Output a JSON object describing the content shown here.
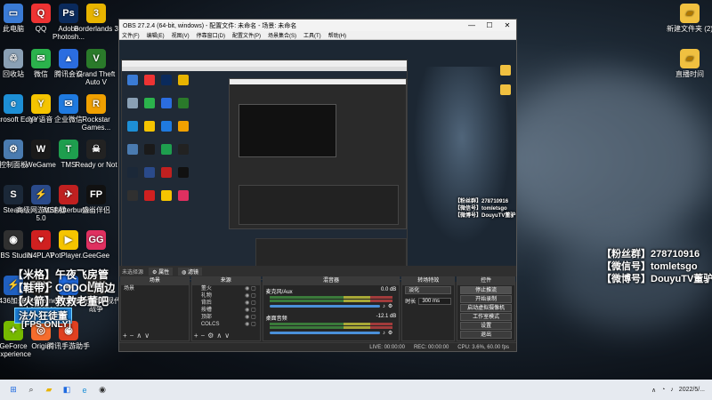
{
  "desktop_left": [
    {
      "label": "此电脑",
      "color": "#3a7bd5",
      "glyph": "▭"
    },
    {
      "label": "QQ",
      "color": "#e33",
      "glyph": "Q"
    },
    {
      "label": "Adobe Photosh...",
      "color": "#0a2a5c",
      "glyph": "Ps"
    },
    {
      "label": "Borderlands 3",
      "color": "#e8b400",
      "glyph": "3"
    },
    {
      "label": "回收站",
      "color": "#8aa0b5",
      "glyph": "♲"
    },
    {
      "label": "微信",
      "color": "#2bb24c",
      "glyph": "✉"
    },
    {
      "label": "腾讯会议",
      "color": "#2b6de0",
      "glyph": "▲"
    },
    {
      "label": "Grand Theft Auto V",
      "color": "#2a7a2a",
      "glyph": "V"
    },
    {
      "label": "Microsoft Edge",
      "color": "#1d8fd6",
      "glyph": "e"
    },
    {
      "label": "YY语音",
      "color": "#f5c400",
      "glyph": "Y"
    },
    {
      "label": "企业微信",
      "color": "#1f7ae0",
      "glyph": "✉"
    },
    {
      "label": "Rockstar Games...",
      "color": "#f0a000",
      "glyph": "R"
    },
    {
      "label": "控制面板",
      "color": "#4a7bb0",
      "glyph": "⚙"
    },
    {
      "label": "WeGame",
      "color": "#1a1a1a",
      "glyph": "W"
    },
    {
      "label": "TMS",
      "color": "#1e9e4e",
      "glyph": "T"
    },
    {
      "label": "Ready or Not",
      "color": "#222",
      "glyph": "☠"
    },
    {
      "label": "Steam",
      "color": "#1b2838",
      "glyph": "S"
    },
    {
      "label": "高级网游加速器5.0",
      "color": "#2a4a8a",
      "glyph": "⚡"
    },
    {
      "label": "MSI Afterburner",
      "color": "#c02020",
      "glyph": "✈"
    },
    {
      "label": "盛当伴侣",
      "color": "#111",
      "glyph": "FP"
    },
    {
      "label": "OBS Studio",
      "color": "#303030",
      "glyph": "◉"
    },
    {
      "label": "N4PLAY",
      "color": "#d02020",
      "glyph": "♥"
    },
    {
      "label": "PotPlayer...",
      "color": "#f5c400",
      "glyph": "▶"
    },
    {
      "label": "GeeGee",
      "color": "#e03060",
      "glyph": "GG"
    },
    {
      "label": "3436加速器",
      "color": "#2060c0",
      "glyph": "⚡"
    },
    {
      "label": "Epic Games Launcher",
      "color": "#222",
      "glyph": "EPIC"
    },
    {
      "label": "ToDesk",
      "color": "#1f6ae0",
      "glyph": "☁"
    },
    {
      "label": "使命召唤：现代战争",
      "color": "#333",
      "glyph": "MW"
    },
    {
      "label": "GeForce Experience",
      "color": "#76b900",
      "glyph": "✦"
    },
    {
      "label": "Origin",
      "color": "#f56c2d",
      "glyph": "◎"
    },
    {
      "label": "腾讯手游助手",
      "color": "#e04020",
      "glyph": "◉"
    }
  ],
  "desktop_right": [
    {
      "label": "新建文件夹 (2)",
      "color": "#f0c040",
      "glyph": "▰"
    },
    {
      "label": "直播时间",
      "color": "#f0c040",
      "glyph": "▰"
    }
  ],
  "overlay_right": {
    "fans": "【粉丝群】278710916",
    "wechat": "【微信号】tomletsgo",
    "weibo": "【微博号】DouyuTV董驴"
  },
  "overlay_left": {
    "line1": "【米格】午夜飞房管",
    "line2": "【鞋带】CODOL周边",
    "line3": "【火箭】救救老董吧",
    "badge": "法外狂徒董",
    "fps": "[FPS ONLY]"
  },
  "obs": {
    "title": "OBS 27.2.4 (64-bit, windows) - 配置文件: 未命名 - 场景: 未命名",
    "menu": [
      "文件(F)",
      "编辑(E)",
      "视图(V)",
      "停靠窗口(D)",
      "配置文件(P)",
      "场景集合(S)",
      "工具(T)",
      "帮助(H)"
    ],
    "no_source": "未选择源",
    "props_tab": "属性",
    "filters_tab": "滤镜",
    "scenes_header": "场景",
    "scenes": [
      "场景"
    ],
    "sources_header": "来源",
    "sources": [
      "董火",
      "礼物",
      "背后",
      "按槽",
      "顶部",
      "COLCS"
    ],
    "mixer_header": "混音器",
    "mixer": [
      {
        "name": "麦克风/Aux",
        "db": "0.0 dB"
      },
      {
        "name": "桌面音频",
        "db": "-12.1 dB"
      }
    ],
    "transitions_header": "转场特效",
    "transition_type": "淡化",
    "duration_label": "时长",
    "duration_value": "300 ms",
    "controls_header": "控件",
    "controls": [
      "停止推流",
      "开始录制",
      "启动虚拟摄像机",
      "工作室模式",
      "设置",
      "退出"
    ],
    "status": {
      "live": "LIVE: 00:00:00",
      "rec": "REC: 00:00:00",
      "cpu": "CPU: 3.6%, 60.00 fps"
    }
  },
  "taskbar": {
    "apps": [
      {
        "name": "windows-icon",
        "glyph": "⊞",
        "color": "#1f6ae0"
      },
      {
        "name": "search-icon",
        "glyph": "⌕",
        "color": "#333"
      },
      {
        "name": "file-explorer-icon",
        "glyph": "▰",
        "color": "#e8b400"
      },
      {
        "name": "store-icon",
        "glyph": "◧",
        "color": "#1f6ae0"
      },
      {
        "name": "edge-icon",
        "glyph": "e",
        "color": "#1d8fd6"
      },
      {
        "name": "obs-icon",
        "glyph": "◉",
        "color": "#303030"
      }
    ],
    "clock": "2022/5/..."
  }
}
